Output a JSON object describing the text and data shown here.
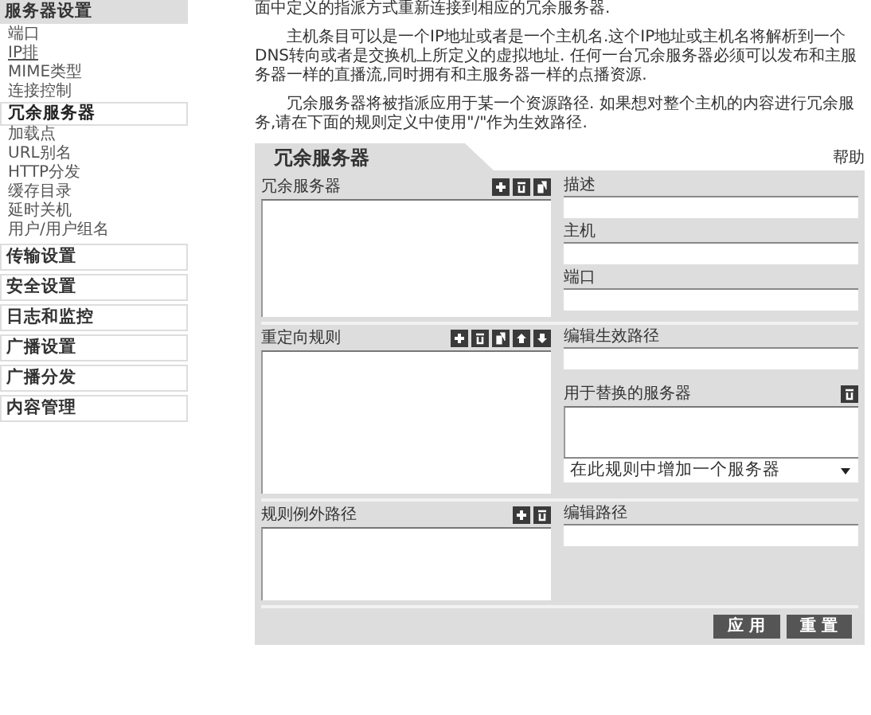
{
  "sidebar": {
    "sections": [
      {
        "label": "服务器设置",
        "expanded": true,
        "children": [
          {
            "label": "端口",
            "hovered": false,
            "selected": false
          },
          {
            "label": "IP排",
            "hovered": true,
            "selected": false
          },
          {
            "label": "MIME类型",
            "hovered": false,
            "selected": false
          },
          {
            "label": "连接控制",
            "hovered": false,
            "selected": false
          },
          {
            "label": "冗余服务器",
            "hovered": false,
            "selected": true
          },
          {
            "label": "加载点",
            "hovered": false,
            "selected": false
          },
          {
            "label": "URL别名",
            "hovered": false,
            "selected": false
          },
          {
            "label": "HTTP分发",
            "hovered": false,
            "selected": false
          },
          {
            "label": "缓存目录",
            "hovered": false,
            "selected": false
          },
          {
            "label": "延时关机",
            "hovered": false,
            "selected": false
          },
          {
            "label": "用户/用户组名",
            "hovered": false,
            "selected": false
          }
        ]
      },
      {
        "label": "传输设置",
        "expanded": false
      },
      {
        "label": "安全设置",
        "expanded": false
      },
      {
        "label": "日志和监控",
        "expanded": false
      },
      {
        "label": "广播设置",
        "expanded": false
      },
      {
        "label": "广播分发",
        "expanded": false
      },
      {
        "label": "内容管理",
        "expanded": false
      }
    ]
  },
  "intro": [
    "面中定义的指派方式重新连接到相应的冗余服务器.",
    "主机条目可以是一个IP地址或者是一个主机名.这个IP地址或主机名将解析到一个DNS转向或者是交换机上所定义的虚拟地址. 任何一台冗余服务器必须可以发布和主服务器一样的直播流,同时拥有和主服务器一样的点播资源.",
    "冗余服务器将被指派应用于某一个资源路径. 如果想对整个主机的内容进行冗余服务,请在下面的规则定义中使用\"/\"作为生效路径."
  ],
  "panel": {
    "title": "冗余服务器",
    "help": "帮助",
    "sections": [
      {
        "list_label": "冗余服务器",
        "tools": [
          {
            "kind": "add"
          },
          {
            "kind": "delete"
          },
          {
            "kind": "copy"
          }
        ],
        "fields": [
          {
            "kind": "text",
            "label": "描述"
          },
          {
            "kind": "text",
            "label": "主机"
          },
          {
            "kind": "text",
            "label": "端口"
          }
        ]
      },
      {
        "list_label": "重定向规则",
        "tools": [
          {
            "kind": "add"
          },
          {
            "kind": "delete"
          },
          {
            "kind": "copy"
          },
          {
            "kind": "up"
          },
          {
            "kind": "down"
          }
        ],
        "fields": [
          {
            "kind": "text",
            "label": "编辑生效路径"
          },
          {
            "kind": "list",
            "label": "用于替换的服务器",
            "tools": [
              {
                "kind": "delete"
              }
            ]
          },
          {
            "kind": "select",
            "value": "在此规则中增加一个服务器"
          }
        ]
      },
      {
        "list_label": "规则例外路径",
        "tools": [
          {
            "kind": "add"
          },
          {
            "kind": "delete"
          }
        ],
        "fields": [
          {
            "kind": "text",
            "label": "编辑路径"
          }
        ]
      }
    ],
    "buttons": [
      "应 用",
      "重 置"
    ]
  }
}
